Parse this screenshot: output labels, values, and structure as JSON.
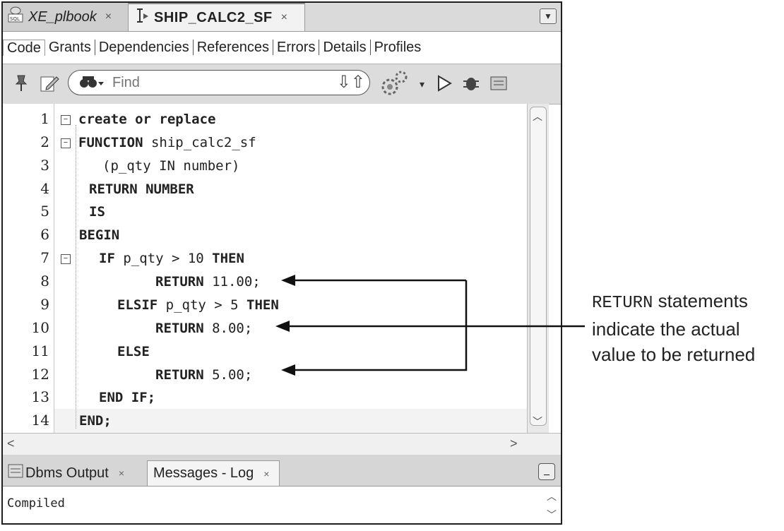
{
  "tabs": [
    {
      "label": "XE_plbook",
      "close": "×"
    },
    {
      "label": "SHIP_CALC2_SF",
      "close": "×"
    }
  ],
  "subtabs": [
    "Code",
    "Grants",
    "Dependencies",
    "References",
    "Errors",
    "Details",
    "Profiles"
  ],
  "toolbar": {
    "find_placeholder": "Find"
  },
  "editor": {
    "line_numbers": [
      "1",
      "2",
      "3",
      "4",
      "5",
      "6",
      "7",
      "8",
      "9",
      "10",
      "11",
      "12",
      "13",
      "14"
    ],
    "lines": {
      "l1": "create or replace",
      "l2a": "FUNCTION",
      "l2b": " ship_calc2_sf",
      "l3": "(p_qty IN number)",
      "l4": "RETURN NUMBER",
      "l5": "IS",
      "l6": "BEGIN",
      "l7a": "IF",
      "l7b": " p_qty > 10 ",
      "l7c": "THEN",
      "l8a": "RETURN",
      "l8b": " 11.00;",
      "l9a": "ELSIF",
      "l9b": " p_qty > 5 ",
      "l9c": "THEN",
      "l10a": "RETURN",
      "l10b": " 8.00;",
      "l11": "ELSE",
      "l12a": "RETURN",
      "l12b": " 5.00;",
      "l13": "END IF;",
      "l14": "END;"
    }
  },
  "bottom_tabs": [
    {
      "label": "Dbms Output",
      "close": "×"
    },
    {
      "label": "Messages - Log",
      "close": "×"
    }
  ],
  "output": {
    "message": "Compiled"
  },
  "annotation": {
    "keyword": "RETURN",
    "line1_rest": " statements",
    "line2": "indicate the actual",
    "line3": "value to be returned"
  },
  "icons": [
    "sql-worksheet-icon",
    "function-icon",
    "pin-icon",
    "edit-icon",
    "binoculars-icon",
    "find-down-icon",
    "find-up-icon",
    "gears-icon",
    "run-icon",
    "debug-icon",
    "profile-icon",
    "messages-icon"
  ]
}
